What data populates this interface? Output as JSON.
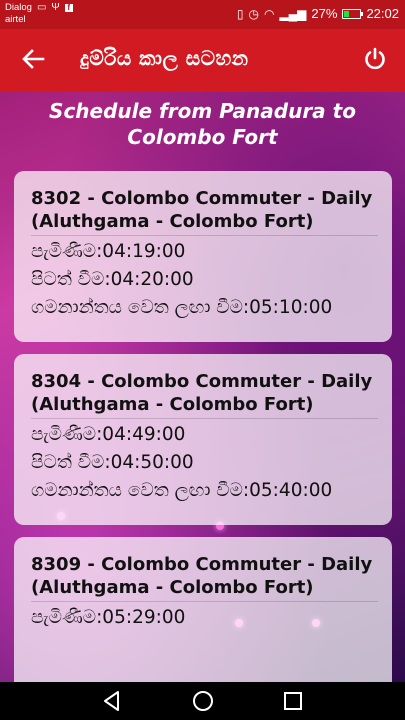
{
  "status_bar": {
    "carrier_line1": "Dialog",
    "carrier_line2": "airtel",
    "battery_percent": "27%",
    "battery_level": 0.27,
    "time": "22:02"
  },
  "app_bar": {
    "title": "දුම්රිය කාල සටහන"
  },
  "heading": "Schedule from Panadura to Colombo Fort",
  "trains": [
    {
      "title_line1": "8302 - Colombo  Commuter - Daily",
      "title_line2": "(Aluthgama - Colombo Fort)",
      "arrival": "පැමිණීම:04:19:00",
      "departure": "පිටත් වීම:04:20:00",
      "destination_arrival": "ගමනාන්තය වෙත ලඟා වීම:05:10:00"
    },
    {
      "title_line1": "8304 - Colombo  Commuter - Daily",
      "title_line2": "(Aluthgama - Colombo Fort)",
      "arrival": "පැමිණීම:04:49:00",
      "departure": "පිටත් වීම:04:50:00",
      "destination_arrival": "ගමනාන්තය වෙත ලඟා වීම:05:40:00"
    },
    {
      "title_line1": "8309 - Colombo  Commuter - Daily",
      "title_line2": "(Aluthgama - Colombo Fort)",
      "arrival": "පැමිණීම:05:29:00"
    }
  ],
  "colors": {
    "status_bar": "#b8141c",
    "app_bar": "#d21a23",
    "card": "#ffffffb8"
  },
  "icons": {
    "back": "arrow-left-icon",
    "power": "power-icon",
    "nav_back": "triangle-back-icon",
    "nav_home": "circle-home-icon",
    "nav_recent": "square-recent-icon"
  }
}
